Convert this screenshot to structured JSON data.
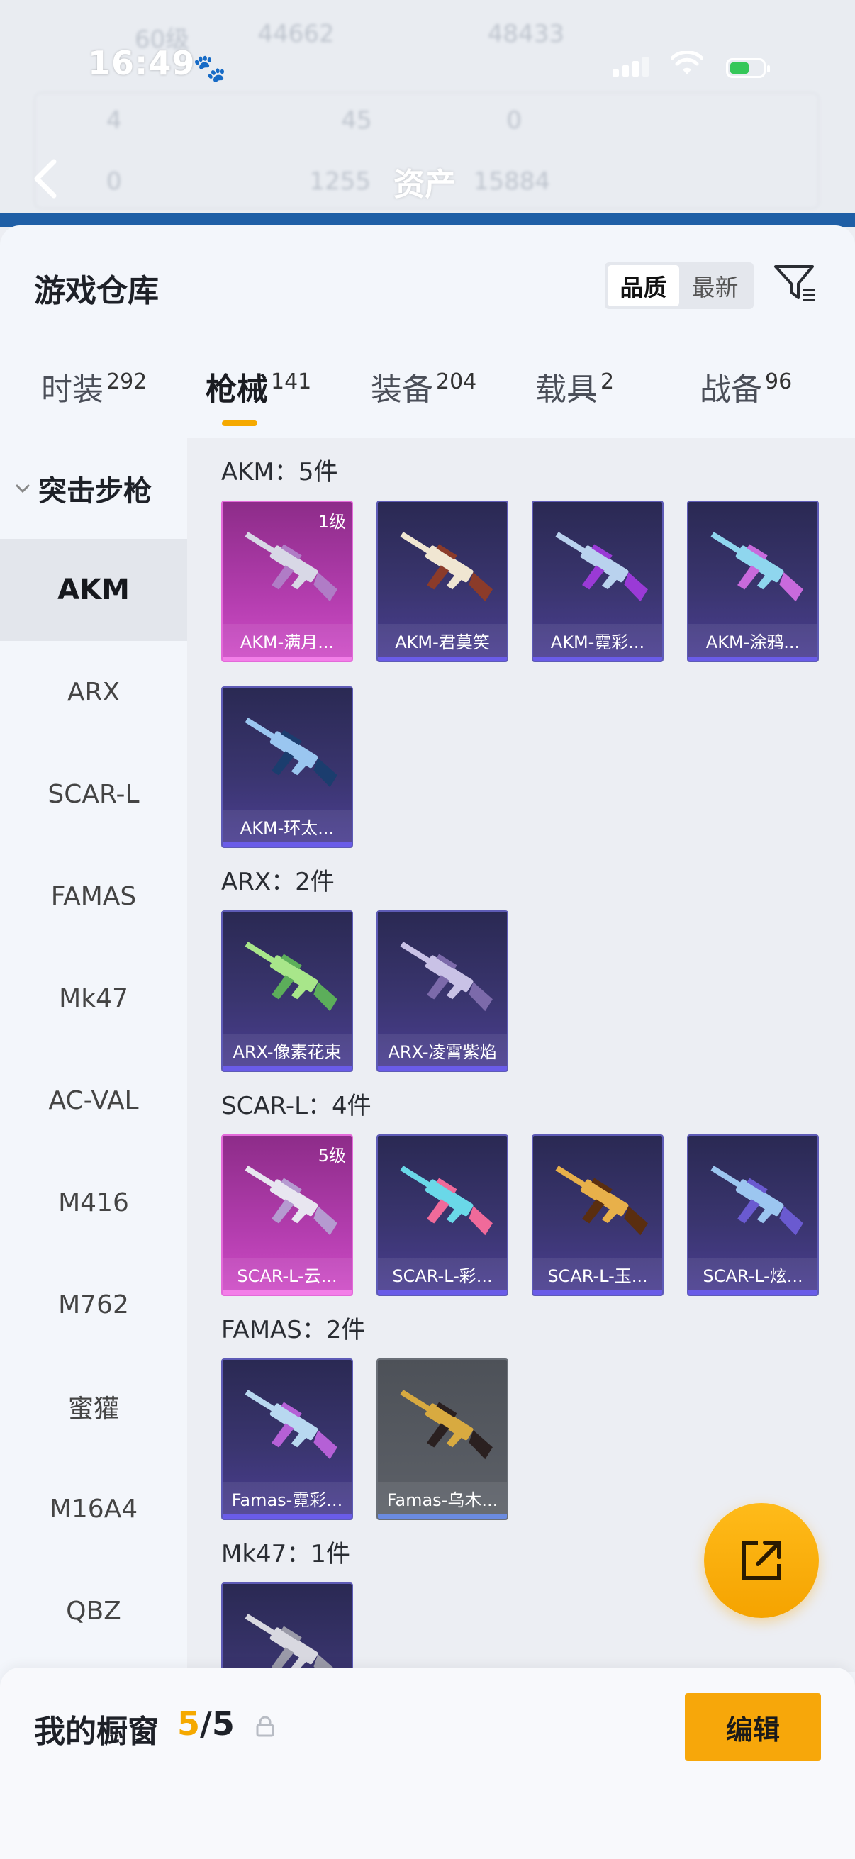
{
  "status_bar": {
    "time": "16:49"
  },
  "header": {
    "title": "资产",
    "blurred_row1": [
      "60级",
      "44662",
      "48433"
    ],
    "blurred_row2": [
      "4",
      "45",
      "0"
    ],
    "blurred_row3": [
      "0",
      "1255",
      "15884"
    ]
  },
  "sheet": {
    "title": "游戏仓库",
    "sort_options": [
      "品质",
      "最新"
    ],
    "active_sort": "品质"
  },
  "tabs": [
    {
      "label": "时装",
      "count": "292"
    },
    {
      "label": "枪械",
      "count": "141"
    },
    {
      "label": "装备",
      "count": "204"
    },
    {
      "label": "载具",
      "count": "2"
    },
    {
      "label": "战备",
      "count": "96"
    }
  ],
  "active_tab": "枪械",
  "sidebar": {
    "category": "突击步枪",
    "items": [
      "AKM",
      "ARX",
      "SCAR-L",
      "FAMAS",
      "Mk47",
      "AC-VAL",
      "M416",
      "M762",
      "蜜獾",
      "M16A4",
      "QBZ"
    ],
    "active": "AKM"
  },
  "groups": [
    {
      "title": "AKM：5件",
      "items": [
        {
          "name": "AKM-满月...",
          "level": "1级",
          "rarity": "pink"
        },
        {
          "name": "AKM-君莫笑",
          "rarity": "purple"
        },
        {
          "name": "AKM-霓彩...",
          "rarity": "purple"
        },
        {
          "name": "AKM-涂鸦...",
          "rarity": "purple"
        },
        {
          "name": "AKM-环太...",
          "rarity": "purple"
        }
      ]
    },
    {
      "title": "ARX：2件",
      "items": [
        {
          "name": "ARX-像素花束",
          "rarity": "purple"
        },
        {
          "name": "ARX-凌霄紫焰",
          "rarity": "purple"
        }
      ]
    },
    {
      "title": "SCAR-L：4件",
      "items": [
        {
          "name": "SCAR-L-云...",
          "level": "5级",
          "rarity": "pink"
        },
        {
          "name": "SCAR-L-彩...",
          "rarity": "purple"
        },
        {
          "name": "SCAR-L-玉...",
          "rarity": "purple"
        },
        {
          "name": "SCAR-L-炫...",
          "rarity": "purple"
        }
      ]
    },
    {
      "title": "FAMAS：2件",
      "items": [
        {
          "name": "Famas-霓彩...",
          "rarity": "purple"
        },
        {
          "name": "Famas-乌木...",
          "rarity": "gray"
        }
      ]
    },
    {
      "title": "Mk47：1件",
      "items": [
        {
          "name": "",
          "rarity": "purple"
        }
      ]
    }
  ],
  "showcase": {
    "title": "我的橱窗",
    "current": "5",
    "total": "/5",
    "edit_label": "编辑"
  },
  "colors": {
    "accent": "#f5a900",
    "purple_card": "#3a356f",
    "pink_card": "#b33dae"
  }
}
